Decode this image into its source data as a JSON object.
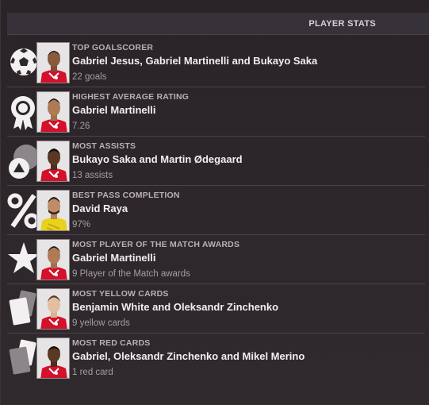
{
  "header": {
    "title": "PLAYER STATS"
  },
  "stats": [
    {
      "category": "TOP GOALSCORER",
      "players": "Gabriel Jesus, Gabriel Martinelli and Bukayo Saka",
      "value": "22 goals",
      "icon": "football-icon",
      "kit": "red"
    },
    {
      "category": "HIGHEST AVERAGE RATING",
      "players": "Gabriel Martinelli",
      "value": "7.26",
      "icon": "rosette-award-icon",
      "kit": "red"
    },
    {
      "category": "MOST ASSISTS",
      "players": "Bukayo Saka and Martin Ødegaard",
      "value": "13 assists",
      "icon": "assist-ball-icon",
      "kit": "red"
    },
    {
      "category": "BEST PASS COMPLETION",
      "players": "David Raya",
      "value": "97%",
      "icon": "percent-icon",
      "kit": "yellow"
    },
    {
      "category": "MOST PLAYER OF THE MATCH AWARDS",
      "players": "Gabriel Martinelli",
      "value": "9 Player of the Match awards",
      "icon": "star-icon",
      "kit": "red"
    },
    {
      "category": "MOST YELLOW CARDS",
      "players": "Benjamin White and Oleksandr Zinchenko",
      "value": "9 yellow cards",
      "icon": "yellow-card-icon",
      "kit": "red"
    },
    {
      "category": "MOST RED CARDS",
      "players": "Gabriel, Oleksandr Zinchenko and Mikel Merino",
      "value": "1 red card",
      "icon": "red-card-icon",
      "kit": "red"
    }
  ]
}
